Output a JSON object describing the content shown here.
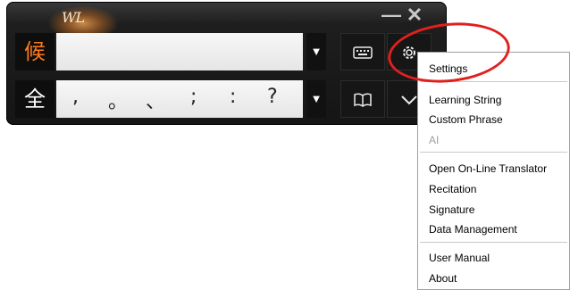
{
  "ime": {
    "logo_mark": "WL",
    "minimize_glyph": "—",
    "close_glyph": "✕",
    "row1": {
      "mode_char": "候",
      "dropdown_glyph": "▼"
    },
    "row2": {
      "mode_char": "全",
      "punctuation": [
        ",",
        "。",
        "、",
        ";",
        ":",
        "?"
      ],
      "dropdown_glyph": "▼"
    },
    "tools": {
      "keyboard_icon": "keyboard-icon",
      "settings_icon": "gear-icon",
      "dictionary_icon": "book-icon",
      "skin_icon": "chevron-icon"
    },
    "colors": {
      "candidate_accent": "#ff7a1a",
      "highlight_circle": "#e0201e"
    }
  },
  "menu": {
    "items": [
      {
        "label": "Settings",
        "enabled": true
      },
      {
        "label": "Learning String",
        "enabled": true
      },
      {
        "label": "Custom Phrase",
        "enabled": true
      },
      {
        "label": "AI",
        "enabled": false
      },
      {
        "label": "Open On-Line Translator",
        "enabled": true
      },
      {
        "label": "Recitation",
        "enabled": true
      },
      {
        "label": "Signature",
        "enabled": true
      },
      {
        "label": "Data Management",
        "enabled": true
      },
      {
        "label": "User Manual",
        "enabled": true
      },
      {
        "label": "About",
        "enabled": true
      }
    ]
  }
}
